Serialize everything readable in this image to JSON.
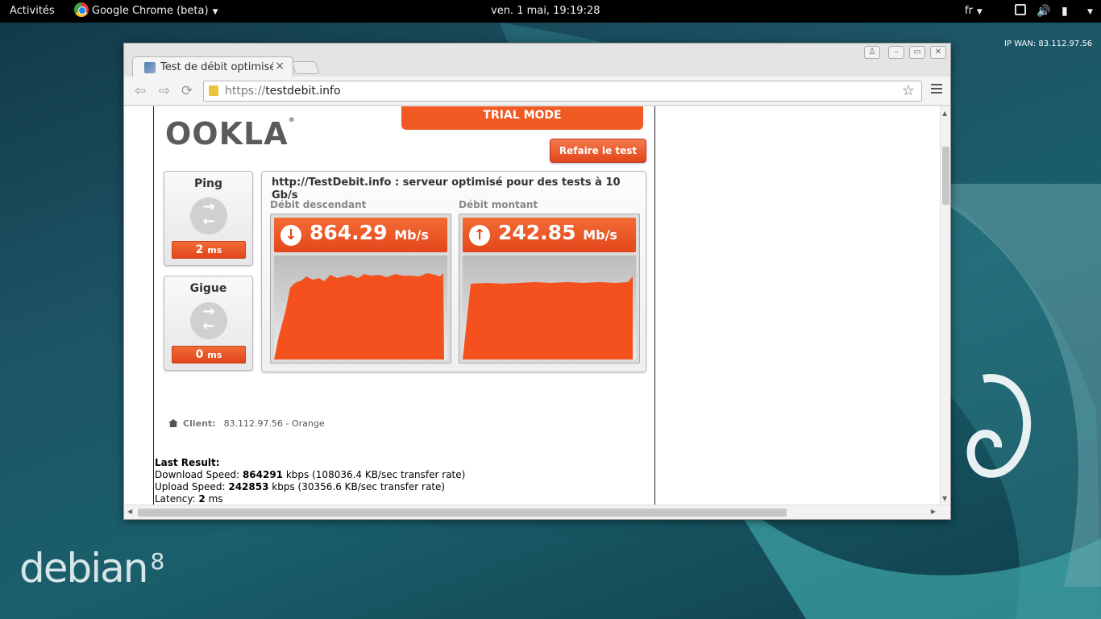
{
  "panel": {
    "activities": "Activités",
    "app_name": "Google Chrome (beta)",
    "clock": "ven.  1 mai, 19:19:28",
    "lang": "fr"
  },
  "desktop": {
    "ip_wan": "IP WAN: 83.112.97.56",
    "debian_word": "debian",
    "debian_version": "8"
  },
  "browser": {
    "tab_title": "Test de débit optimisé",
    "tab_close": "×",
    "url_proto": "https://",
    "url_host": "testdebit.info"
  },
  "page": {
    "trial_mode": "TRIAL MODE",
    "logo": "OOKLA",
    "retest": "Refaire le test",
    "ping": {
      "label": "Ping",
      "value": "2",
      "unit": "ms"
    },
    "jitter": {
      "label": "Gigue",
      "value": "0",
      "unit": "ms"
    },
    "server_line": "http://TestDebit.info : serveur optimisé pour des tests à 10 Gb/s",
    "download": {
      "label": "Débit descendant",
      "value": "864.29",
      "unit": "Mb/s"
    },
    "upload": {
      "label": "Débit montant",
      "value": "242.85",
      "unit": "Mb/s"
    },
    "client": {
      "key": "Client:",
      "value": "83.112.97.56 - Orange"
    },
    "last_result": {
      "title": "Last Result:",
      "download_prefix": "Download Speed: ",
      "download_value": "864291",
      "download_suffix": " kbps (108036.4 KB/sec transfer rate)",
      "upload_prefix": "Upload Speed: ",
      "upload_value": "242853",
      "upload_suffix": " kbps (30356.6 KB/sec transfer rate)",
      "latency_prefix": "Latency: ",
      "latency_value": "2",
      "latency_suffix": " ms"
    }
  },
  "colors": {
    "accent": "#f15a22",
    "graph_fill": "#f4511e"
  }
}
